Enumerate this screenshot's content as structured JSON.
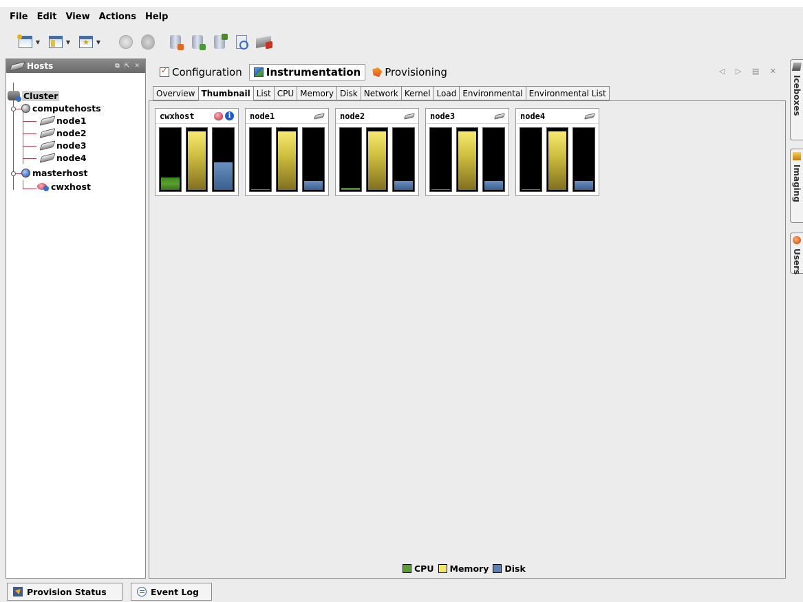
{
  "menu": [
    "File",
    "Edit",
    "View",
    "Actions",
    "Help"
  ],
  "hosts_panel": {
    "title": "Hosts",
    "tree": {
      "root": "Cluster",
      "group1": "computehosts",
      "nodes": [
        "node1",
        "node2",
        "node3",
        "node4"
      ],
      "group2": "masterhost",
      "master_child": "cwxhost"
    }
  },
  "main_tabs": [
    "Configuration",
    "Instrumentation",
    "Provisioning"
  ],
  "active_main_tab": "Instrumentation",
  "sub_tabs": [
    "Overview",
    "Thumbnail",
    "List",
    "CPU",
    "Memory",
    "Disk",
    "Network",
    "Kernel",
    "Load",
    "Environmental",
    "Environmental List"
  ],
  "active_sub_tab": "Thumbnail",
  "thumbnails": [
    {
      "name": "cwxhost",
      "icons": [
        "red-host-icon",
        "info-icon"
      ],
      "cpu": 0.2,
      "memory": 0.97,
      "disk": 0.45
    },
    {
      "name": "node1",
      "icons": [
        "disk-icon"
      ],
      "cpu": 0.01,
      "memory": 0.97,
      "disk": 0.15
    },
    {
      "name": "node2",
      "icons": [
        "disk-icon"
      ],
      "cpu": 0.03,
      "memory": 0.97,
      "disk": 0.15
    },
    {
      "name": "node3",
      "icons": [
        "disk-icon"
      ],
      "cpu": 0.01,
      "memory": 0.97,
      "disk": 0.15
    },
    {
      "name": "node4",
      "icons": [
        "disk-icon"
      ],
      "cpu": 0.01,
      "memory": 0.97,
      "disk": 0.15
    }
  ],
  "legend": {
    "cpu": "CPU",
    "memory": "Memory",
    "disk": "Disk"
  },
  "colors": {
    "cpu": "#5aa030",
    "memory": "#f4e860",
    "disk": "#5a80b8"
  },
  "side_tabs": [
    "Iceboxes",
    "Imaging",
    "Users"
  ],
  "bottom_tabs": [
    "Provision Status",
    "Event Log"
  ]
}
